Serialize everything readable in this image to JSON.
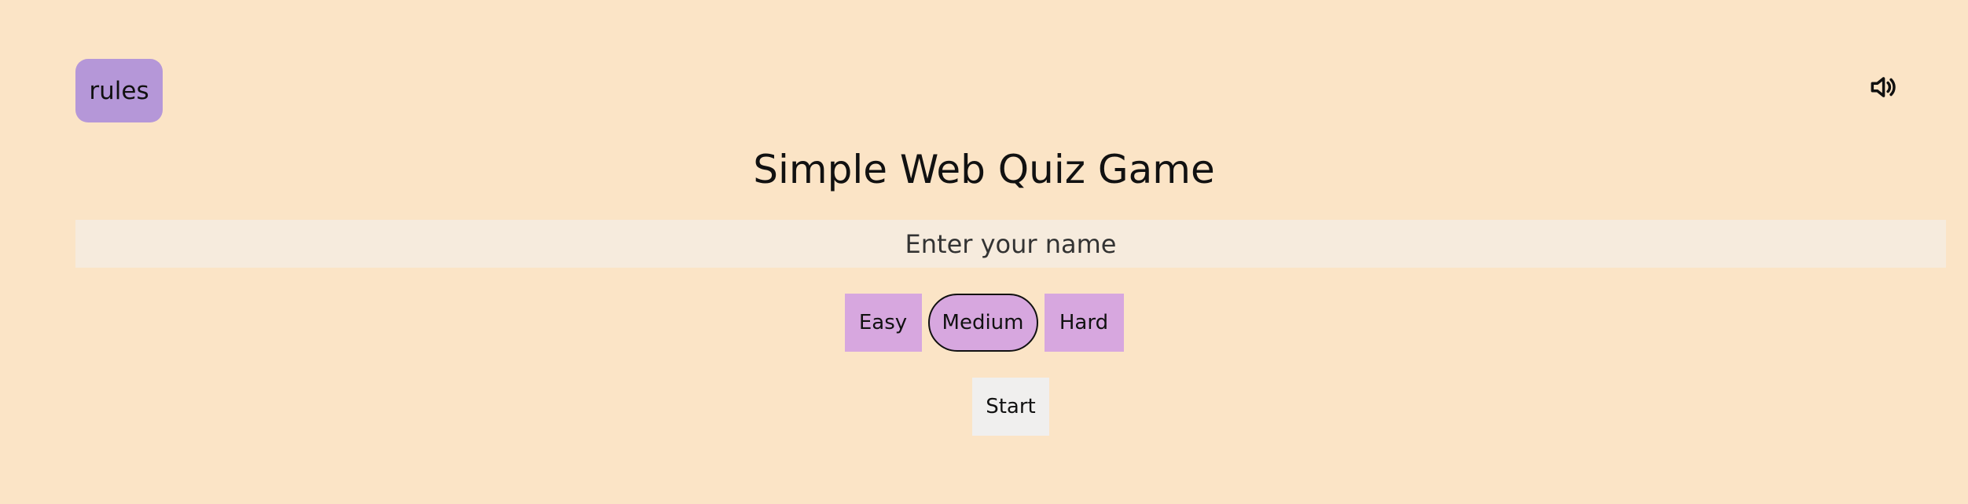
{
  "header": {
    "rules_label": "rules",
    "sound_icon": "speaker-volume-icon"
  },
  "main": {
    "title": "Simple Web Quiz Game",
    "name_input": {
      "placeholder": "Enter your name",
      "value": ""
    },
    "difficulty": {
      "options": [
        "Easy",
        "Medium",
        "Hard"
      ],
      "selected": "Medium"
    },
    "start_label": "Start"
  },
  "colors": {
    "background": "#fbe4c6",
    "rules_button": "#b597d8",
    "difficulty_button": "#d7a7df",
    "input_background": "#f6ebdd",
    "start_button": "#f0efee"
  }
}
